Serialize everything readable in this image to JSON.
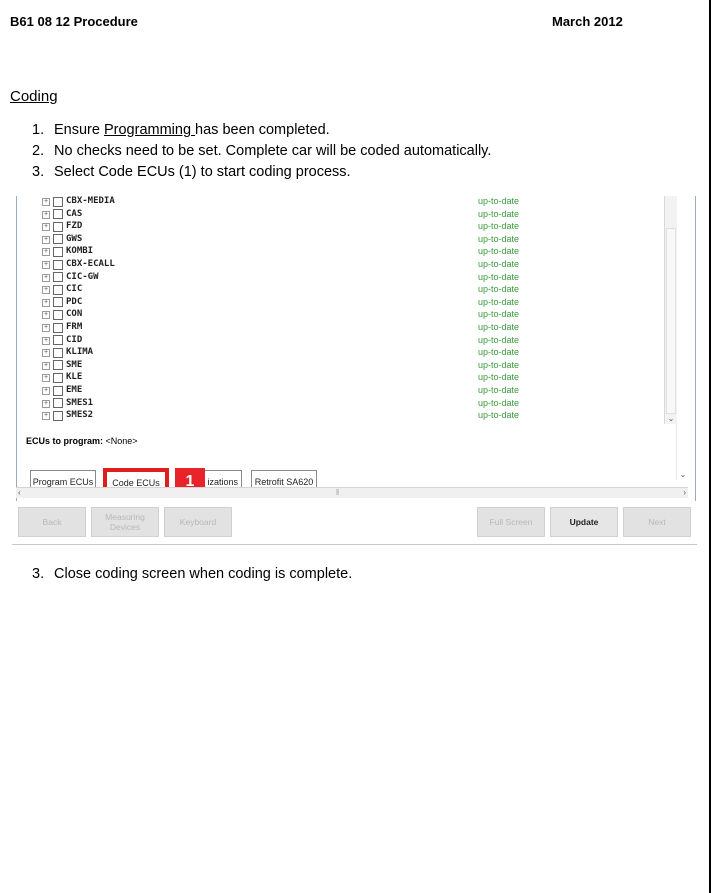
{
  "header": {
    "left": "B61 08 12 Procedure",
    "right": "March 2012"
  },
  "section_title": "Coding",
  "steps": [
    {
      "num": "1.",
      "pre": "Ensure ",
      "link": "Programming ",
      "post": "has been completed."
    },
    {
      "num": "2.",
      "text": "No checks need to be set. Complete car will be coded automatically."
    },
    {
      "num": "3.",
      "text": "Select Code ECUs (1) to start coding process."
    }
  ],
  "ecu_list": [
    {
      "name": "CBX-MEDIA",
      "status": "up-to-date"
    },
    {
      "name": "CAS",
      "status": "up-to-date"
    },
    {
      "name": "FZD",
      "status": "up-to-date"
    },
    {
      "name": "GWS",
      "status": "up-to-date"
    },
    {
      "name": "KOMBI",
      "status": "up-to-date"
    },
    {
      "name": "CBX-ECALL",
      "status": "up-to-date"
    },
    {
      "name": "CIC-GW",
      "status": "up-to-date"
    },
    {
      "name": "CIC",
      "status": "up-to-date"
    },
    {
      "name": "PDC",
      "status": "up-to-date"
    },
    {
      "name": "CON",
      "status": "up-to-date"
    },
    {
      "name": "FRM",
      "status": "up-to-date"
    },
    {
      "name": "CID",
      "status": "up-to-date"
    },
    {
      "name": "KLIMA",
      "status": "up-to-date"
    },
    {
      "name": "SME",
      "status": "up-to-date"
    },
    {
      "name": "KLE",
      "status": "up-to-date"
    },
    {
      "name": "EME",
      "status": "up-to-date"
    },
    {
      "name": "SMES1",
      "status": "up-to-date"
    },
    {
      "name": "SMES2",
      "status": "up-to-date"
    }
  ],
  "ecus_to_program": {
    "label": "ECUs to program:",
    "value": "<None>"
  },
  "tabs": {
    "program": "Program ECUs",
    "code": "Code ECUs",
    "partial": "izations",
    "retrofit": "Retrofit SA620"
  },
  "callout": "1",
  "buttons": {
    "back": "Back",
    "measuring": "Measuring Devices",
    "keyboard": "Keyboard",
    "full_screen": "Full Screen",
    "update": "Update",
    "next": "Next"
  },
  "final_step": {
    "num": "3.",
    "text": "Close coding screen when coding is complete."
  },
  "colors": {
    "accent_red": "#e8232a",
    "status_green": "#3a9a3a"
  }
}
